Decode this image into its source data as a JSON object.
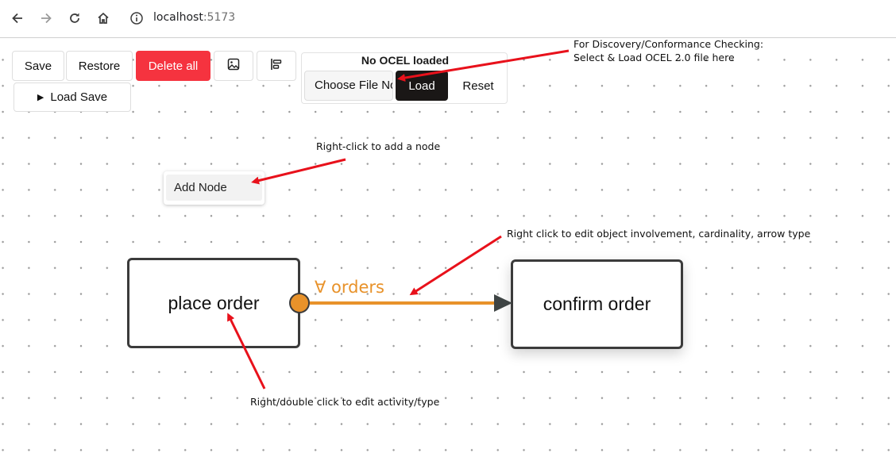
{
  "browser": {
    "url_host": "localhost",
    "url_port": ":5173",
    "icons": [
      "back-arrow-icon",
      "forward-arrow-icon",
      "reload-icon",
      "home-icon",
      "site-info-icon"
    ]
  },
  "toolbar": {
    "save_label": "Save",
    "restore_label": "Restore",
    "delete_all_label": "Delete all",
    "image_icon": "image-icon",
    "layout_icon": "align-layout-icon",
    "load_save_label": "Load Save"
  },
  "ocel": {
    "status": "No OCEL loaded",
    "choose_file_label": "Choose File No file chosen",
    "load_label": "Load",
    "reset_label": "Reset"
  },
  "context_menu": {
    "items": [
      {
        "label": "Add Node"
      }
    ]
  },
  "nodes": [
    {
      "label": "place order"
    },
    {
      "label": "confirm order"
    }
  ],
  "edge": {
    "label": "∀ orders",
    "color": "#e8922a"
  },
  "annotations": {
    "ocel_hint_line1": "For Discovery/Conformance Checking:",
    "ocel_hint_line2": "Select & Load OCEL 2.0 file here",
    "add_node_hint": "Right-click to add a node",
    "edge_hint": "Right click to edit object involvement, cardinality, arrow type",
    "node_hint": "Right/double click to edit activity/type",
    "arrow_color": "#e8111b"
  }
}
